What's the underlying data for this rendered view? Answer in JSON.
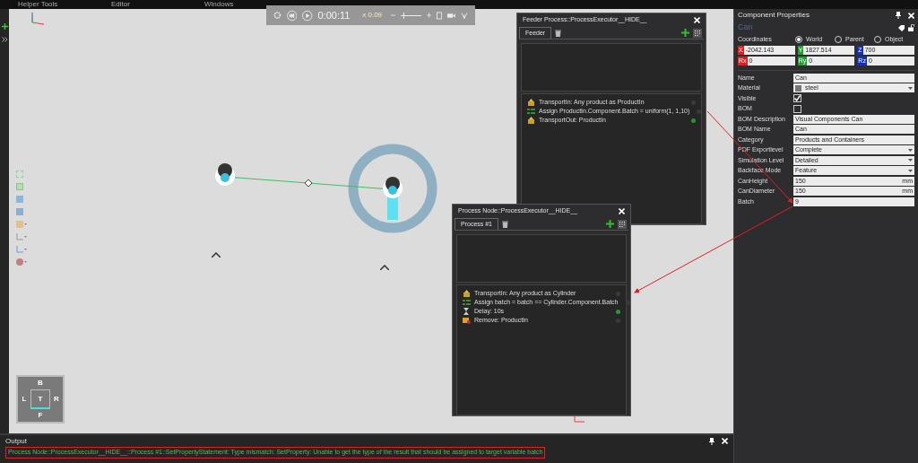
{
  "menu": [
    "Helper Tools",
    "Editor",
    "Windows"
  ],
  "playback": {
    "time": "0:00:11",
    "speed": "x 0.09",
    "level": 0.1
  },
  "viewcube": {
    "top": "B",
    "left": "L",
    "center": "T",
    "right": "R",
    "bottom": "F"
  },
  "process_windows": [
    {
      "title": "Feeder Process::ProcessExecutor__HIDE__",
      "tabs": [
        {
          "label": "Feeder",
          "selected": true
        }
      ],
      "statements": [
        {
          "kind": "transport_in",
          "text": "TransportIn: Any product as ProductIn",
          "current": false
        },
        {
          "kind": "assign",
          "text": "Assign ProductIn.Component.Batch = uniform(1, 1,10)",
          "current": false
        },
        {
          "kind": "transport_out",
          "text": "TransportOut: ProductIn",
          "current": true
        }
      ]
    },
    {
      "title": "Process Node::ProcessExecutor__HIDE__",
      "tabs": [
        {
          "label": "Process #1",
          "selected": true
        }
      ],
      "statements": [
        {
          "kind": "transport_in",
          "text": "TransportIn: Any product as Cylinder",
          "current": false
        },
        {
          "kind": "assign",
          "text": "Assign batch = batch == Cylinder.Component.Batch",
          "current": false
        },
        {
          "kind": "delay",
          "text": "Delay: 10s",
          "current": true
        },
        {
          "kind": "remove",
          "text": "Remove: ProductIn",
          "current": false
        }
      ]
    }
  ],
  "properties": {
    "title": "Component Properties",
    "component": "Can",
    "coordinates": {
      "label": "Coordinates",
      "options": [
        {
          "label": "World",
          "selected": true
        },
        {
          "label": "Parent",
          "selected": false
        },
        {
          "label": "Object",
          "selected": false
        }
      ]
    },
    "position": [
      {
        "axis": "X",
        "value": "-2042.143",
        "color": "#e02020"
      },
      {
        "axis": "Y",
        "value": "1827.514",
        "color": "#20a030"
      },
      {
        "axis": "Z",
        "value": "700",
        "color": "#1030c0"
      }
    ],
    "rotation": [
      {
        "axis": "Rx",
        "value": "0",
        "color": "#e02020"
      },
      {
        "axis": "Ry",
        "value": "0",
        "color": "#20a030"
      },
      {
        "axis": "Rz",
        "value": "0",
        "color": "#1030c0"
      }
    ],
    "rows": [
      {
        "kind": "text",
        "label": "Name",
        "value": "Can"
      },
      {
        "kind": "material",
        "label": "Material",
        "value": "steel"
      },
      {
        "kind": "checkbox",
        "label": "Visible",
        "checked": true
      },
      {
        "kind": "checkbox",
        "label": "BOM",
        "checked": false
      },
      {
        "kind": "text",
        "label": "BOM Description",
        "value": "Visual Components Can"
      },
      {
        "kind": "text",
        "label": "BOM Name",
        "value": "Can"
      },
      {
        "kind": "text",
        "label": "Category",
        "value": "Products and Containers"
      },
      {
        "kind": "dropdown",
        "label": "PDF Exportlevel",
        "value": "Complete"
      },
      {
        "kind": "dropdown",
        "label": "Simulation Level",
        "value": "Detailed"
      },
      {
        "kind": "dropdown",
        "label": "Backface Mode",
        "value": "Feature"
      },
      {
        "kind": "unit",
        "label": "CanHeight",
        "value": "150",
        "unit": "mm"
      },
      {
        "kind": "unit",
        "label": "CanDiameter",
        "value": "150",
        "unit": "mm"
      },
      {
        "kind": "text",
        "label": "Batch",
        "value": "9"
      }
    ]
  },
  "output": {
    "title": "Output",
    "message": "Process Node::ProcessExecutor__HIDE__::Process #1::SetPropertyStatement: Type mismatch: SetProperty: Unable to get the type of the result that should be assigned to target variable batch"
  }
}
